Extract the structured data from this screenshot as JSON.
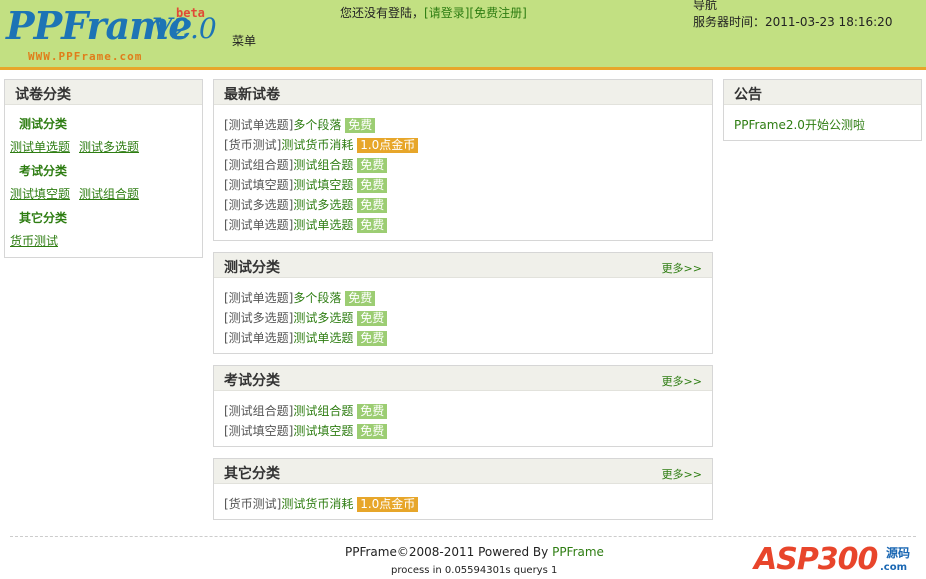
{
  "header": {
    "logo": {
      "main": "PPFrame",
      "version": "V2.0",
      "beta": "beta",
      "url": "WWW.PPFrame.com"
    },
    "menu_label": "菜单",
    "login": {
      "prefix": "您还没有登陆，",
      "login_link": "[请登录]",
      "register_link": "[免费注册]"
    },
    "nav_label": "导航",
    "server_time": "服务器时间：2011-03-23 18:16:20"
  },
  "sidebar": {
    "title": "试卷分类",
    "groups": [
      {
        "name": "测试分类",
        "links": [
          "测试单选题",
          "测试多选题"
        ]
      },
      {
        "name": "考试分类",
        "links": [
          "测试填空题",
          "测试组合题"
        ]
      },
      {
        "name": "其它分类",
        "links": [
          "货币测试"
        ]
      }
    ]
  },
  "latest": {
    "title": "最新试卷",
    "rows": [
      {
        "cat": "[测试单选题]",
        "title": "多个段落",
        "tag": "免费",
        "tag_type": "free"
      },
      {
        "cat": "[货币测试]",
        "title": "测试货币消耗",
        "tag": "1.0点金币",
        "tag_type": "coin"
      },
      {
        "cat": "[测试组合题]",
        "title": "测试组合题",
        "tag": "免费",
        "tag_type": "free"
      },
      {
        "cat": "[测试填空题]",
        "title": "测试填空题",
        "tag": "免费",
        "tag_type": "free"
      },
      {
        "cat": "[测试多选题]",
        "title": "测试多选题",
        "tag": "免费",
        "tag_type": "free"
      },
      {
        "cat": "[测试单选题]",
        "title": "测试单选题",
        "tag": "免费",
        "tag_type": "free"
      }
    ]
  },
  "test_category": {
    "title": "测试分类",
    "more": "更多>>",
    "rows": [
      {
        "cat": "[测试单选题]",
        "title": "多个段落",
        "tag": "免费",
        "tag_type": "free"
      },
      {
        "cat": "[测试多选题]",
        "title": "测试多选题",
        "tag": "免费",
        "tag_type": "free"
      },
      {
        "cat": "[测试单选题]",
        "title": "测试单选题",
        "tag": "免费",
        "tag_type": "free"
      }
    ]
  },
  "exam_category": {
    "title": "考试分类",
    "more": "更多>>",
    "rows": [
      {
        "cat": "[测试组合题]",
        "title": "测试组合题",
        "tag": "免费",
        "tag_type": "free"
      },
      {
        "cat": "[测试填空题]",
        "title": "测试填空题",
        "tag": "免费",
        "tag_type": "free"
      }
    ]
  },
  "other_category": {
    "title": "其它分类",
    "more": "更多>>",
    "rows": [
      {
        "cat": "[货币测试]",
        "title": "测试货币消耗",
        "tag": "1.0点金币",
        "tag_type": "coin"
      }
    ]
  },
  "notice": {
    "title": "公告",
    "items": [
      "PPFrame2.0开始公测啦"
    ]
  },
  "footer": {
    "copyright_prefix": "PPFrame©2008-2011 Powered By ",
    "copyright_link": "PPFrame",
    "process": "process in 0.05594301s querys 1"
  },
  "watermark": {
    "text": "ASP300",
    "cn": "源码",
    "com": ".com"
  },
  "colors": {
    "header_bg": "#c2e082",
    "header_border": "#e7a62a",
    "link": "#2e7d12",
    "tag_free": "#9ccd73",
    "tag_coin": "#e7a62a",
    "logo_blue": "#1d74b5"
  }
}
